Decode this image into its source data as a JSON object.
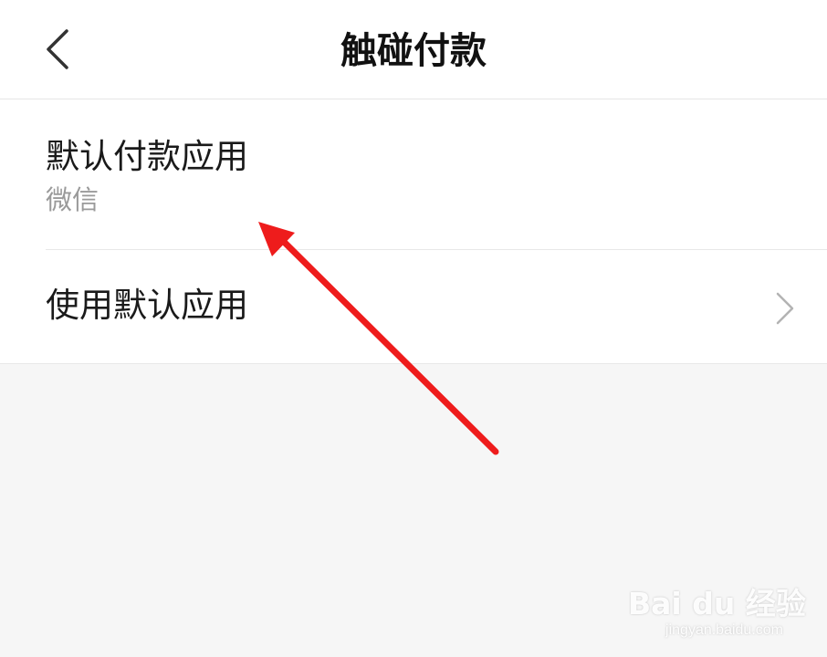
{
  "header": {
    "title": "触碰付款",
    "back_icon": "chevron-left-icon"
  },
  "settings": {
    "items": [
      {
        "label": "默认付款应用",
        "value": "微信"
      },
      {
        "label": "使用默认应用",
        "icon": "chevron-right-icon"
      }
    ]
  },
  "annotation": {
    "icon": "red-arrow-icon",
    "color": "#ee1c1c"
  },
  "watermark": {
    "logo": "Bai du 经验",
    "url": "jingyan.baidu.com"
  },
  "colors": {
    "background": "#f6f6f6",
    "surface": "#ffffff",
    "divider": "#e8e8e8",
    "text_primary": "#1a1a1a",
    "text_secondary": "#9a9a9a"
  }
}
